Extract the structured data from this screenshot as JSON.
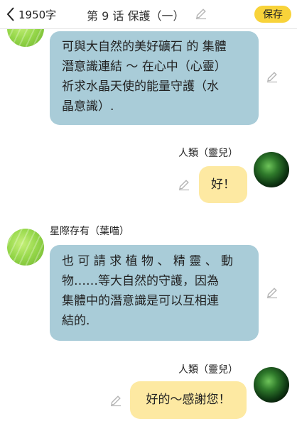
{
  "header": {
    "back_icon": "chevron-left-icon",
    "word_count": "1950字",
    "title": "第 9 话 保護（一）",
    "edit_icon": "pencil-icon",
    "save_label": "保存"
  },
  "colors": {
    "save_button": "#f8d33a",
    "bubble_other": "#a9ccd8",
    "bubble_self": "#fde9a2",
    "edit_icon": "#b5b5b5"
  },
  "messages": [
    {
      "side": "left",
      "avatar": "leaf-avatar",
      "text_lines": [
        "可與大自然的美好礦石 的 集體",
        "潛意識連結 ～ 在心中（心靈）",
        "祈求水晶天使的能量守護（水",
        "晶意識）."
      ]
    },
    {
      "side": "right",
      "sender": "人類（靈兒）",
      "avatar": "orb-avatar",
      "text": "好！"
    },
    {
      "side": "left",
      "sender": "星際存有（葉喵）",
      "avatar": "leaf-avatar",
      "text_lines": [
        "也 可 請 求 植 物 、 精 靈 、 動",
        "物……等大自然的守護，因為",
        "集體中的潛意識是可以互相連",
        "結的."
      ]
    },
    {
      "side": "right",
      "sender": "人類（靈兒）",
      "avatar": "orb-avatar",
      "text": "好的～感謝您！"
    }
  ]
}
